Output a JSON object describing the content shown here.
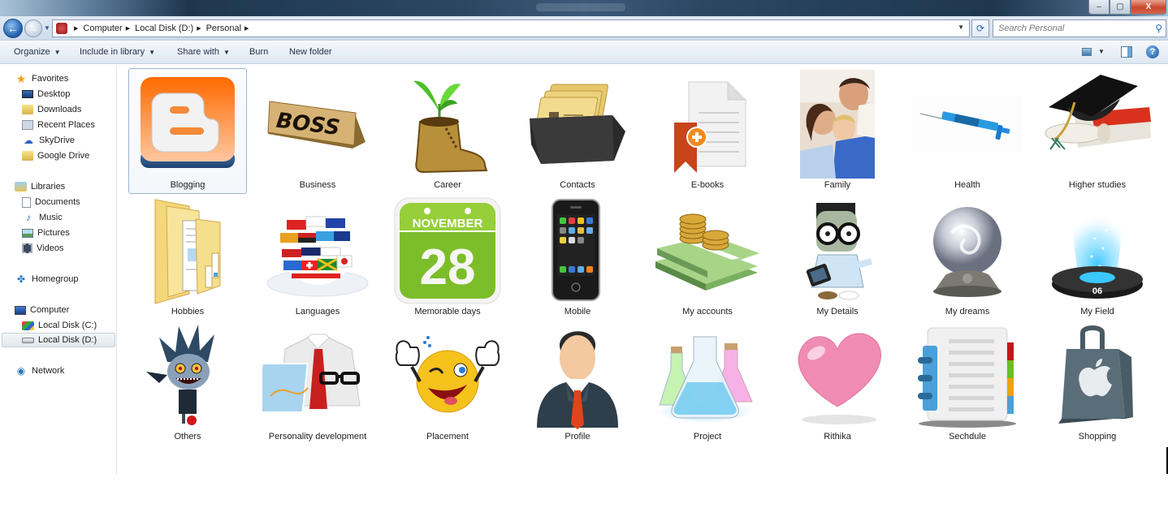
{
  "window": {
    "controls": {
      "minimize": "–",
      "maximize": "▢",
      "close": "X"
    }
  },
  "navigation": {
    "back_glyph": "←",
    "forward_glyph": "→",
    "breadcrumb": [
      "Computer",
      "Local Disk (D:)",
      "Personal"
    ],
    "refresh_glyph": "⟳",
    "search_placeholder": "Search Personal",
    "search_glyph": "⚲"
  },
  "toolbar": {
    "organize": "Organize",
    "include_in_library": "Include in library",
    "share_with": "Share with",
    "burn": "Burn",
    "new_folder": "New folder",
    "help_glyph": "?"
  },
  "sidebar": {
    "favorites": {
      "label": "Favorites",
      "items": [
        "Desktop",
        "Downloads",
        "Recent Places",
        "SkyDrive",
        "Google Drive"
      ]
    },
    "libraries": {
      "label": "Libraries",
      "items": [
        "Documents",
        "Music",
        "Pictures",
        "Videos"
      ]
    },
    "homegroup": "Homegroup",
    "computer": {
      "label": "Computer",
      "items": [
        "Local Disk (C:)",
        "Local Disk (D:)"
      ],
      "selected": "Local Disk (D:)"
    },
    "network": "Network"
  },
  "folders": [
    {
      "name": "Blogging",
      "icon": "blogger-icon",
      "selected": true
    },
    {
      "name": "Business",
      "icon": "boss-nameplate-icon"
    },
    {
      "name": "Career",
      "icon": "boot-sprout-icon"
    },
    {
      "name": "Contacts",
      "icon": "card-file-box-icon"
    },
    {
      "name": "E-books",
      "icon": "document-bookmark-icon"
    },
    {
      "name": "Family",
      "icon": "family-photo-icon"
    },
    {
      "name": "Health",
      "icon": "syringe-icon"
    },
    {
      "name": "Higher studies",
      "icon": "graduation-cap-icon"
    },
    {
      "name": "Hobbies",
      "icon": "folder-icon"
    },
    {
      "name": "Languages",
      "icon": "flag-globe-icon"
    },
    {
      "name": "Memorable days",
      "icon": "calendar-icon",
      "calendar_month": "NOVEMBER",
      "calendar_day": "28"
    },
    {
      "name": "Mobile",
      "icon": "smartphone-icon"
    },
    {
      "name": "My accounts",
      "icon": "money-coins-icon"
    },
    {
      "name": "My Details",
      "icon": "cartoon-character-icon"
    },
    {
      "name": "My dreams",
      "icon": "crystal-ball-icon"
    },
    {
      "name": "My Field",
      "icon": "hologram-disc-icon",
      "disc_number": "06"
    },
    {
      "name": "Others",
      "icon": "shinigami-character-icon"
    },
    {
      "name": "Personality development",
      "icon": "shirt-tie-glasses-icon"
    },
    {
      "name": "Placement",
      "icon": "thumbs-up-smiley-icon"
    },
    {
      "name": "Profile",
      "icon": "businessman-icon"
    },
    {
      "name": "Project",
      "icon": "lab-flasks-icon"
    },
    {
      "name": "Rithika",
      "icon": "heart-icon"
    },
    {
      "name": "Sechdule",
      "icon": "notebook-tabs-icon"
    },
    {
      "name": "Shopping",
      "icon": "shopping-bag-icon"
    }
  ]
}
